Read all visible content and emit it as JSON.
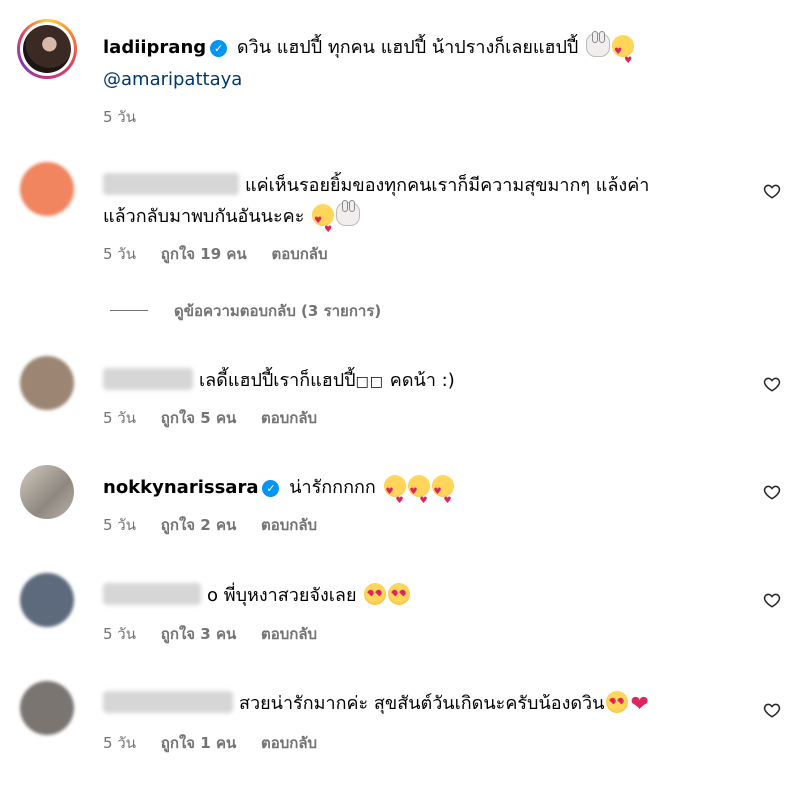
{
  "post_caption": {
    "username": "ladiiprang",
    "verified": true,
    "text": "ดวิน แฮปปี้ ทุกคน แฮปปี้ น้าปรางก็เลยแฮปปี้",
    "emojis": [
      "rabbit-face",
      "smiling-face-with-hearts"
    ],
    "mention": "@amaripattaya",
    "time": "5 วัน"
  },
  "comments": [
    {
      "username_blurred": true,
      "text_line1": "แค่เห็นรอยยิ้มของทุกคนเราก็มีความสุขมากๆ แล้งค่า",
      "text_line2": "แล้วกลับมาพบกันอันนะคะ",
      "emojis": [
        "smiling-face-with-hearts",
        "rabbit-face"
      ],
      "time": "5 วัน",
      "likes": "ถูกใจ 19 คน",
      "reply": "ตอบกลับ",
      "avatar_color": "#f0855f"
    },
    {
      "username_blurred": true,
      "text_line1": "เลดี้แฮปปี้เราก็แฮปปี้",
      "tofu": "□□",
      "text_suffix": "คดน้า :)",
      "time": "5 วัน",
      "likes": "ถูกใจ 5 คน",
      "reply": "ตอบกลับ",
      "avatar_color": "#9c8573"
    },
    {
      "username": "nokkynarissara",
      "verified": true,
      "text_line1": "น่ารักกกกก",
      "emojis": [
        "smiling-face-with-hearts",
        "smiling-face-with-hearts",
        "smiling-face-with-hearts"
      ],
      "time": "5 วัน",
      "likes": "ถูกใจ 2 คน",
      "reply": "ตอบกลับ",
      "avatar_color": "#b8b2a8"
    },
    {
      "username_blurred": true,
      "text_line1": "o พี่บุหงาสวยจังเลย",
      "emojis": [
        "heart-eyes",
        "heart-eyes"
      ],
      "time": "5 วัน",
      "likes": "ถูกใจ 3 คน",
      "reply": "ตอบกลับ",
      "avatar_color": "#5d6a7d"
    },
    {
      "username_blurred": true,
      "text_line1": "สวยน่ารักมากค่ะ สุขสันต์วันเกิดนะครับน้องดวิน",
      "emojis": [
        "heart-eyes",
        "red-heart"
      ],
      "time": "5 วัน",
      "likes": "ถูกใจ 1 คน",
      "reply": "ตอบกลับ",
      "avatar_color": "#7a7571"
    }
  ],
  "view_replies": "ดูข้อความตอบกลับ (3 รายการ)",
  "colors": {
    "meta_text": "#737373",
    "mention": "#00376b",
    "verified": "#0095f6",
    "heart_icon": "#262626"
  }
}
